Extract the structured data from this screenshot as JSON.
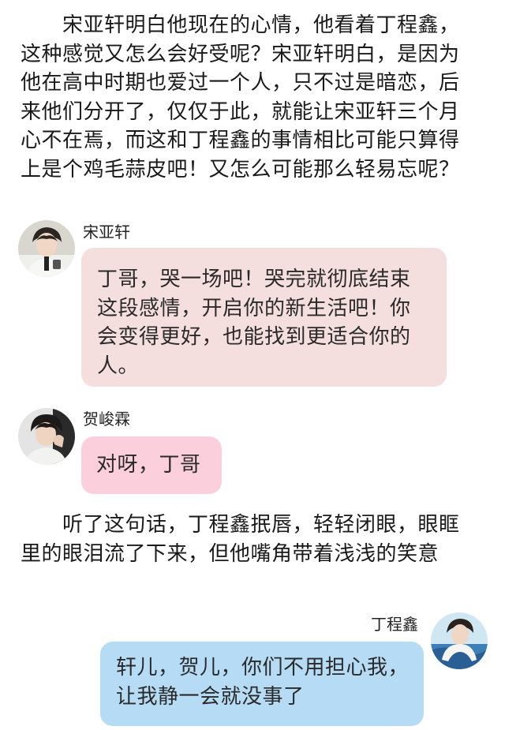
{
  "narration": {
    "paragraph_1": "　　宋亚轩明白他现在的心情，他看着丁程鑫，这种感觉又怎么会好受呢？宋亚轩明白，是因为他在高中时期也爱过一个人，只不过是暗恋，后来他们分开了，仅仅于此，就能让宋亚轩三个月心不在焉，而这和丁程鑫的事情相比可能只算得上是个鸡毛蒜皮吧！又怎么可能那么轻易忘呢？",
    "paragraph_2": "　　听了这句话，丁程鑫抿唇，轻轻闭眼，眼眶里的眼泪流了下来，但他嘴角带着浅浅的笑意"
  },
  "messages": [
    {
      "sender": "宋亚轩",
      "text": "丁哥，哭一场吧！哭完就彻底结束这段感情，开启你的新生活吧！你会变得更好，也能找到更适合你的人。",
      "bubble_color": "#f5dede"
    },
    {
      "sender": "贺峻霖",
      "text": "对呀，丁哥",
      "bubble_color": "#fbd0dc"
    },
    {
      "sender": "丁程鑫",
      "text": "轩儿，贺儿，你们不用担心我，让我静一会就没事了",
      "bubble_color": "#b6dcf5"
    }
  ]
}
